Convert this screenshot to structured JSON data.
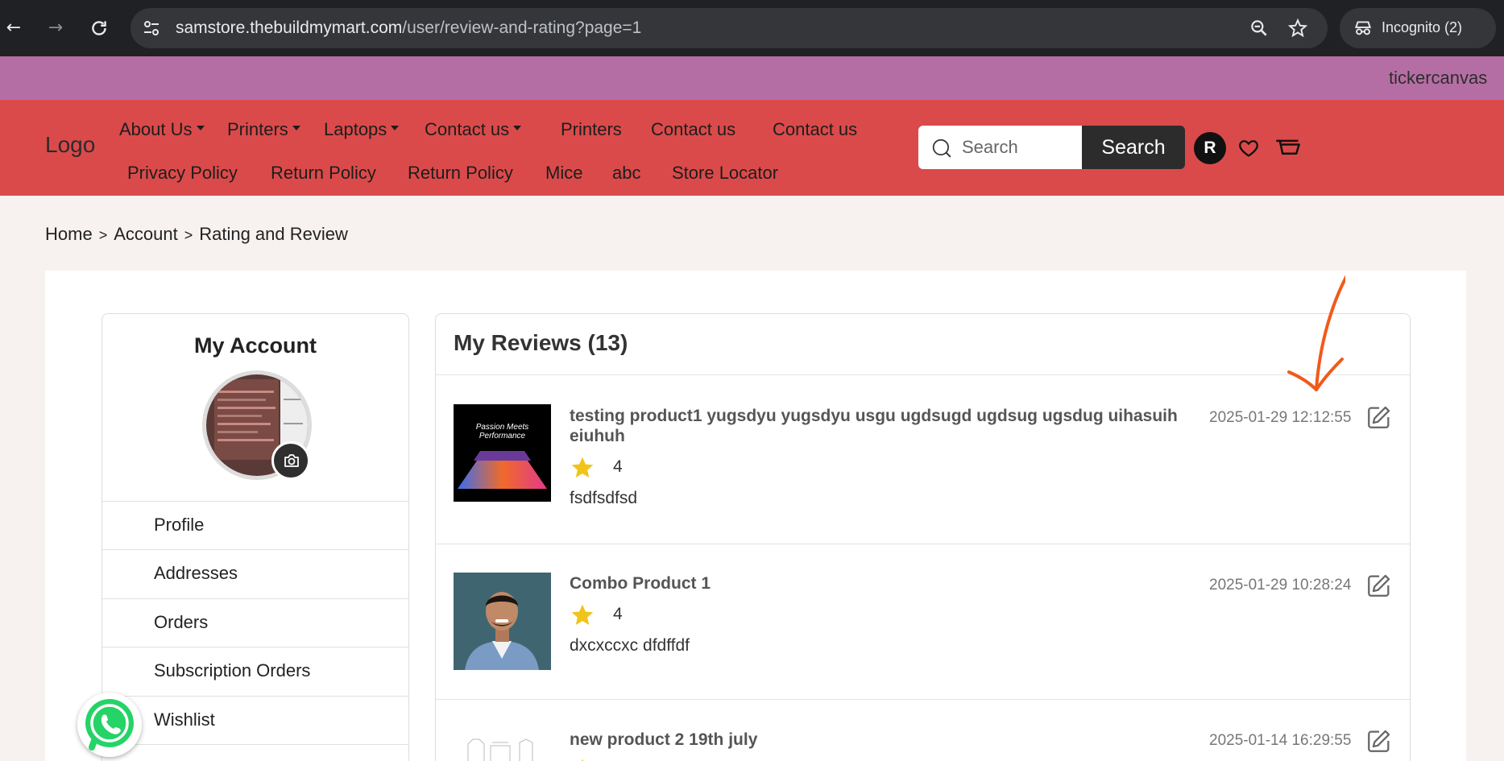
{
  "browser": {
    "url_domain": "samstore.thebuildmymart.com",
    "url_path": "/user/review-and-rating?page=1",
    "incognito_label": "Incognito (2)"
  },
  "ticker": {
    "text": "tickercanvas"
  },
  "header": {
    "logo": "Logo",
    "menu_row1": [
      {
        "label": "About Us",
        "dropdown": true
      },
      {
        "label": "Printers",
        "dropdown": true
      },
      {
        "label": "Laptops",
        "dropdown": true
      },
      {
        "label": "Contact us",
        "dropdown": true
      },
      {
        "label": "Printers",
        "dropdown": false
      },
      {
        "label": "Contact us",
        "dropdown": false
      },
      {
        "label": "Contact us",
        "dropdown": false
      }
    ],
    "menu_row2": [
      "Privacy Policy",
      "Return Policy",
      "Return Policy",
      "Mice",
      "abc",
      "Store Locator"
    ],
    "search_placeholder": "Search",
    "search_button": "Search",
    "user_initial": "R"
  },
  "breadcrumb": [
    "Home",
    "Account",
    "Rating and Review"
  ],
  "account": {
    "title": "My Account",
    "items": [
      "Profile",
      "Addresses",
      "Orders",
      "Subscription Orders",
      "Wishlist"
    ]
  },
  "reviews": {
    "title": "My Reviews (13)",
    "items": [
      {
        "product": "testing product1 yugsdyu yugsdyu usgu ugdsugd ugdsug ugsdug uihasuih eiuhuh",
        "rating": "4",
        "text": "fsdfsdfsd",
        "date": "2025-01-29 12:12:55",
        "thumb_caption": "Passion Meets Performance"
      },
      {
        "product": "Combo Product 1",
        "rating": "4",
        "text": "dxcxccxc dfdffdf",
        "date": "2025-01-29 10:28:24"
      },
      {
        "product": "new product 2 19th july",
        "rating": "",
        "text": "",
        "date": "2025-01-14 16:29:55"
      }
    ]
  },
  "colors": {
    "ticker_bg": "#b56ea4",
    "header_bg": "#db4a4a",
    "star": "#f0c419",
    "annotation_arrow": "#f05a1a",
    "whatsapp": "#25d366"
  }
}
